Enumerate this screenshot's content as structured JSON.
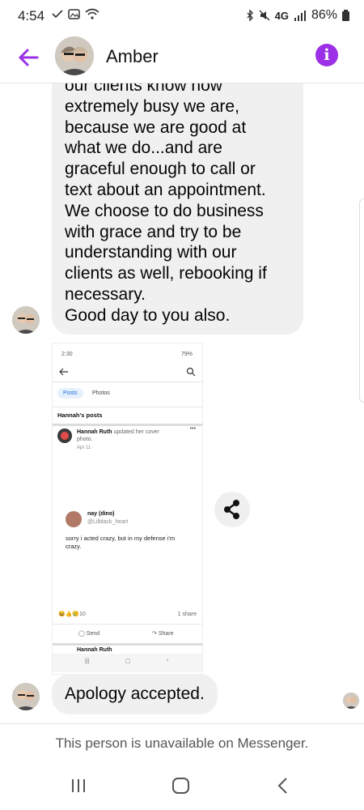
{
  "status_bar": {
    "time": "4:54",
    "network": "4G",
    "battery": "86%"
  },
  "header": {
    "contact_name": "Amber",
    "back_icon": "back-arrow-icon",
    "info_icon": "info-icon",
    "accent_color": "#9b30e7"
  },
  "messages": {
    "long_message_lines": [
      "our clients know how",
      "extremely busy we are,",
      "because we are good at",
      "what we do...and are",
      "graceful enough to call or",
      "text about an appointment.",
      "We choose to do business",
      "with grace and try to be",
      "understanding with our",
      "clients as well, rebooking if",
      "necessary.",
      "Good day to you also."
    ],
    "shared_screenshot": {
      "status_time": "2:30",
      "status_battery": "79%",
      "tab_posts": "Posts",
      "tab_photos": "Photos",
      "section_title": "Hannah's posts",
      "post_author": "Hannah Ruth",
      "post_action": "updated her cover photo.",
      "post_date": "Apr 11 ·",
      "embedded_name": "nay (dino)",
      "embedded_handle": "@Lilblack_heart",
      "embedded_text": "sorry i acted crazy, but in my defense i'm crazy.",
      "reaction_count": "10",
      "shares": "1 share",
      "send_label": "Send",
      "share_label": "Share",
      "next_post_author": "Hannah Ruth"
    },
    "short_message": "Apology accepted."
  },
  "footer": {
    "unavailable_text": "This person is unavailable on Messenger."
  }
}
